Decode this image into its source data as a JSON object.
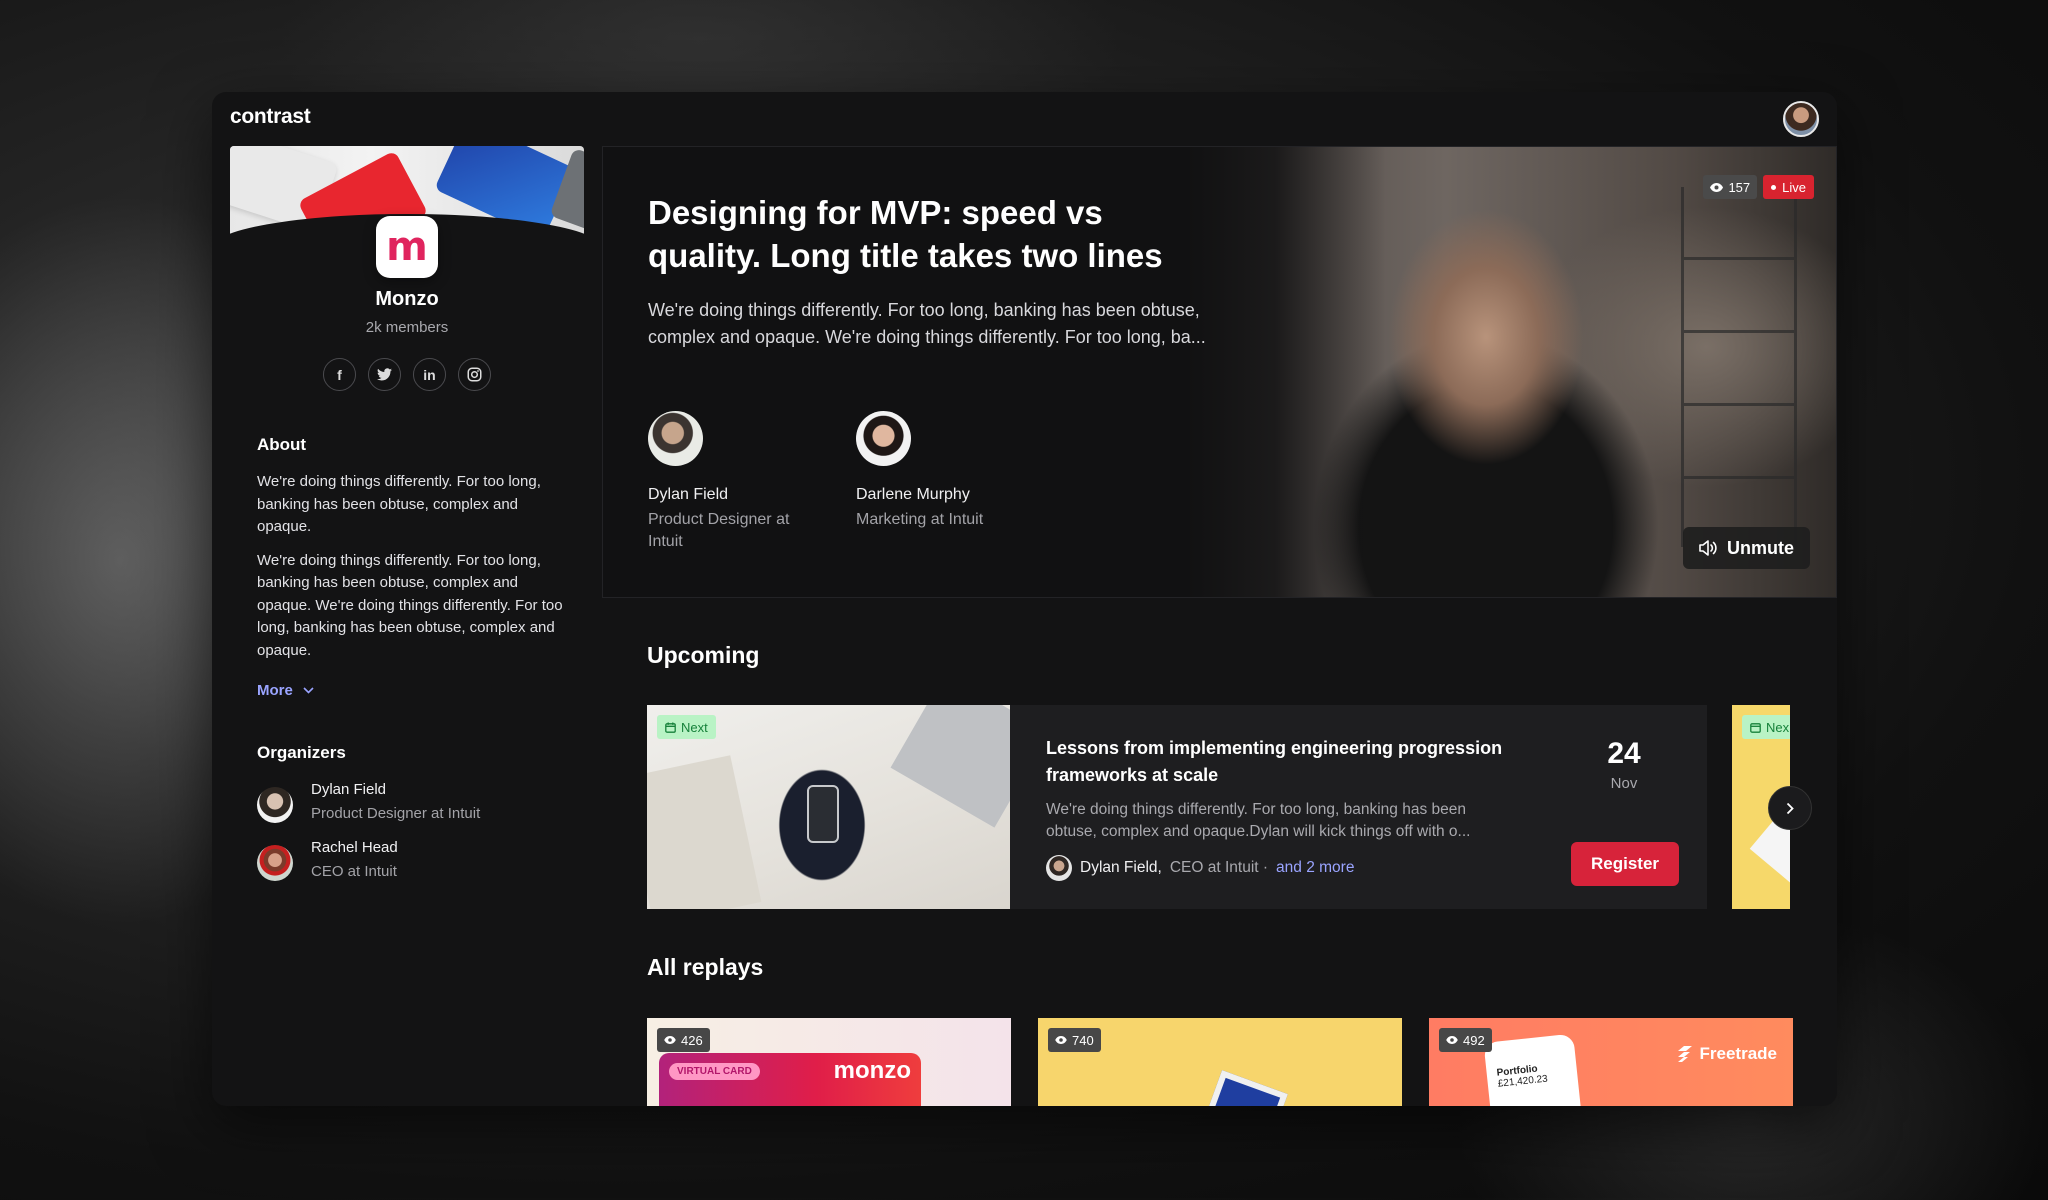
{
  "app": {
    "logo": "contrast"
  },
  "community": {
    "name": "Monzo",
    "logo_letter": "m",
    "members": "2k members",
    "socials": [
      {
        "icon": "facebook-icon",
        "glyph": "f"
      },
      {
        "icon": "twitter-icon",
        "glyph": "t"
      },
      {
        "icon": "linkedin-icon",
        "glyph": "in"
      },
      {
        "icon": "instagram-icon",
        "glyph": "◎"
      }
    ],
    "about_title": "About",
    "about_paragraphs": [
      "We're doing things differently. For too long, banking has been obtuse, complex and opaque.",
      "We're doing things differently. For too long, banking has been obtuse, complex and opaque. We're doing things differently. For too long, banking has been obtuse, complex and opaque."
    ],
    "more_label": "More",
    "organizers_title": "Organizers",
    "organizers": [
      {
        "name": "Dylan Field",
        "role": "Product Designer at Intuit"
      },
      {
        "name": "Rachel Head",
        "role": "CEO at Intuit"
      }
    ]
  },
  "hero": {
    "title": "Designing for MVP: speed vs quality. Long title takes two lines",
    "description": "We're doing things differently. For too long, banking has been obtuse, complex and opaque. We're doing things differently. For too long, ba...",
    "views": "157",
    "live_label": "Live",
    "unmute_label": "Unmute",
    "speakers": [
      {
        "name": "Dylan Field",
        "role": "Product Designer at Intuit"
      },
      {
        "name": "Darlene Murphy",
        "role": "Marketing at Intuit"
      }
    ]
  },
  "upcoming": {
    "title": "Upcoming",
    "next_label": "Next",
    "next_label_partial": "Nex",
    "event": {
      "title": "Lessons from implementing engineering progression frameworks at scale",
      "description": "We're doing things differently. For too long, banking has been obtuse, complex and opaque.Dylan will kick things off with o...",
      "host_name": "Dylan Field,",
      "host_role": "CEO at Intuit ·",
      "more_hosts": "and 2 more",
      "day": "24",
      "month": "Nov",
      "register_label": "Register"
    }
  },
  "replays": {
    "title": "All replays",
    "items": [
      {
        "views": "426",
        "tag": "VIRTUAL CARD",
        "brand": "monzo"
      },
      {
        "views": "740"
      },
      {
        "views": "492",
        "brand": "Freetrade",
        "card_title": "Portfolio",
        "card_value": "£21,420.23"
      }
    ]
  },
  "colors": {
    "accent_link": "#9aa4ff",
    "register_bg": "#d7233a",
    "live_bg": "#d8232f",
    "next_chip_bg": "#b9f3c5"
  }
}
